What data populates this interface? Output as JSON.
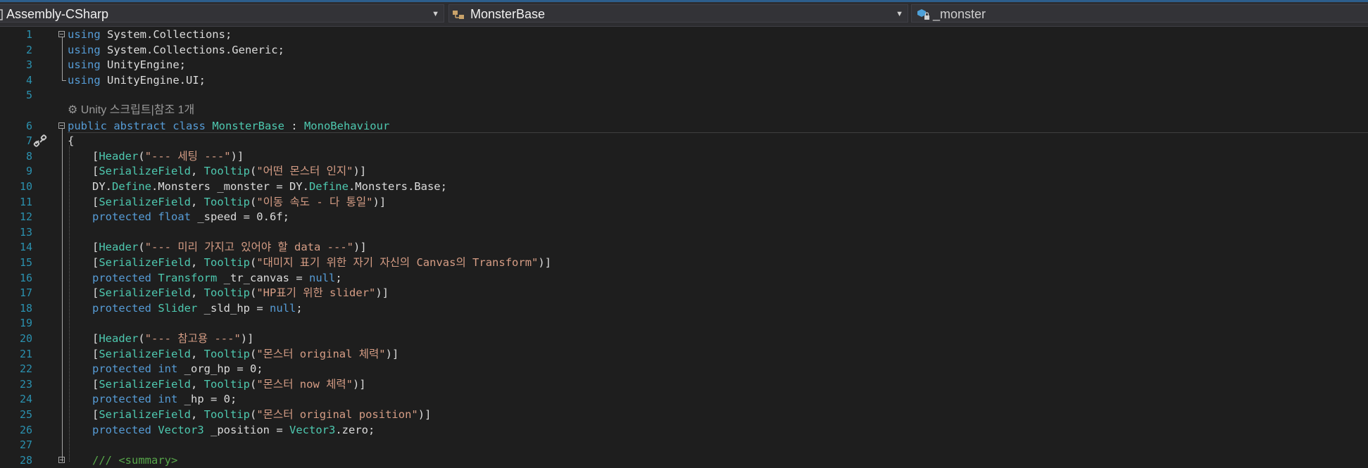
{
  "navbar": {
    "project": "Assembly-CSharp",
    "class": "MonsterBase",
    "member": "_monster"
  },
  "codelens": "Unity 스크립트|참조 1개",
  "lines": [
    {
      "n": "1",
      "toks": [
        [
          "kw",
          "using"
        ],
        [
          "pl",
          " System.Collections;"
        ]
      ]
    },
    {
      "n": "2",
      "toks": [
        [
          "kw",
          "using"
        ],
        [
          "pl",
          " System.Collections.Generic;"
        ]
      ]
    },
    {
      "n": "3",
      "toks": [
        [
          "kw",
          "using"
        ],
        [
          "pl",
          " UnityEngine;"
        ]
      ]
    },
    {
      "n": "4",
      "toks": [
        [
          "kw",
          "using"
        ],
        [
          "pl",
          " UnityEngine.UI;"
        ]
      ]
    },
    {
      "n": "5",
      "toks": []
    },
    {
      "n": "6",
      "toks": [
        [
          "kw",
          "public abstract class"
        ],
        [
          "pl",
          " "
        ],
        [
          "ty",
          "MonsterBase"
        ],
        [
          "pl",
          " : "
        ],
        [
          "ty",
          "MonoBehaviour"
        ]
      ]
    },
    {
      "n": "7",
      "toks": [
        [
          "pl",
          "{"
        ]
      ]
    },
    {
      "n": "8",
      "toks": [
        [
          "pl",
          "["
        ],
        [
          "ty",
          "Header"
        ],
        [
          "pl",
          "("
        ],
        [
          "st",
          "\"--- 세팅 ---\""
        ],
        [
          "pl",
          ")]"
        ]
      ]
    },
    {
      "n": "9",
      "toks": [
        [
          "pl",
          "["
        ],
        [
          "ty",
          "SerializeField"
        ],
        [
          "pl",
          ", "
        ],
        [
          "ty",
          "Tooltip"
        ],
        [
          "pl",
          "("
        ],
        [
          "st",
          "\"어떤 몬스터 인지\""
        ],
        [
          "pl",
          ")]"
        ]
      ]
    },
    {
      "n": "10",
      "toks": [
        [
          "pl",
          "DY."
        ],
        [
          "ty",
          "Define"
        ],
        [
          "pl",
          ".Monsters _monster = DY."
        ],
        [
          "ty",
          "Define"
        ],
        [
          "pl",
          ".Monsters.Base;"
        ]
      ]
    },
    {
      "n": "11",
      "toks": [
        [
          "pl",
          "["
        ],
        [
          "ty",
          "SerializeField"
        ],
        [
          "pl",
          ", "
        ],
        [
          "ty",
          "Tooltip"
        ],
        [
          "pl",
          "("
        ],
        [
          "st",
          "\"이동 속도 - 다 통일\""
        ],
        [
          "pl",
          ")]"
        ]
      ]
    },
    {
      "n": "12",
      "toks": [
        [
          "kw",
          "protected float"
        ],
        [
          "pl",
          " _speed = 0.6f;"
        ]
      ]
    },
    {
      "n": "13",
      "toks": []
    },
    {
      "n": "14",
      "toks": [
        [
          "pl",
          "["
        ],
        [
          "ty",
          "Header"
        ],
        [
          "pl",
          "("
        ],
        [
          "st",
          "\"--- 미리 가지고 있어야 할 data ---\""
        ],
        [
          "pl",
          ")]"
        ]
      ]
    },
    {
      "n": "15",
      "toks": [
        [
          "pl",
          "["
        ],
        [
          "ty",
          "SerializeField"
        ],
        [
          "pl",
          ", "
        ],
        [
          "ty",
          "Tooltip"
        ],
        [
          "pl",
          "("
        ],
        [
          "st",
          "\"대미지 표기 위한 자기 자신의 Canvas의 Transform\""
        ],
        [
          "pl",
          ")]"
        ]
      ]
    },
    {
      "n": "16",
      "toks": [
        [
          "kw",
          "protected"
        ],
        [
          "pl",
          " "
        ],
        [
          "ty",
          "Transform"
        ],
        [
          "pl",
          " _tr_canvas = "
        ],
        [
          "kw",
          "null"
        ],
        [
          "pl",
          ";"
        ]
      ]
    },
    {
      "n": "17",
      "toks": [
        [
          "pl",
          "["
        ],
        [
          "ty",
          "SerializeField"
        ],
        [
          "pl",
          ", "
        ],
        [
          "ty",
          "Tooltip"
        ],
        [
          "pl",
          "("
        ],
        [
          "st",
          "\"HP표기 위한 slider\""
        ],
        [
          "pl",
          ")]"
        ]
      ]
    },
    {
      "n": "18",
      "toks": [
        [
          "kw",
          "protected"
        ],
        [
          "pl",
          " "
        ],
        [
          "ty",
          "Slider"
        ],
        [
          "pl",
          " _sld_hp = "
        ],
        [
          "kw",
          "null"
        ],
        [
          "pl",
          ";"
        ]
      ]
    },
    {
      "n": "19",
      "toks": []
    },
    {
      "n": "20",
      "toks": [
        [
          "pl",
          "["
        ],
        [
          "ty",
          "Header"
        ],
        [
          "pl",
          "("
        ],
        [
          "st",
          "\"--- 참고용 ---\""
        ],
        [
          "pl",
          ")]"
        ]
      ]
    },
    {
      "n": "21",
      "toks": [
        [
          "pl",
          "["
        ],
        [
          "ty",
          "SerializeField"
        ],
        [
          "pl",
          ", "
        ],
        [
          "ty",
          "Tooltip"
        ],
        [
          "pl",
          "("
        ],
        [
          "st",
          "\"몬스터 original 체력\""
        ],
        [
          "pl",
          ")]"
        ]
      ]
    },
    {
      "n": "22",
      "toks": [
        [
          "kw",
          "protected int"
        ],
        [
          "pl",
          " _org_hp = 0;"
        ]
      ]
    },
    {
      "n": "23",
      "toks": [
        [
          "pl",
          "["
        ],
        [
          "ty",
          "SerializeField"
        ],
        [
          "pl",
          ", "
        ],
        [
          "ty",
          "Tooltip"
        ],
        [
          "pl",
          "("
        ],
        [
          "st",
          "\"몬스터 now 체력\""
        ],
        [
          "pl",
          ")]"
        ]
      ]
    },
    {
      "n": "24",
      "toks": [
        [
          "kw",
          "protected int"
        ],
        [
          "pl",
          " _hp = 0;"
        ]
      ]
    },
    {
      "n": "25",
      "toks": [
        [
          "pl",
          "["
        ],
        [
          "ty",
          "SerializeField"
        ],
        [
          "pl",
          ", "
        ],
        [
          "ty",
          "Tooltip"
        ],
        [
          "pl",
          "("
        ],
        [
          "st",
          "\"몬스터 original position\""
        ],
        [
          "pl",
          ")]"
        ]
      ]
    },
    {
      "n": "26",
      "toks": [
        [
          "kw",
          "protected"
        ],
        [
          "pl",
          " "
        ],
        [
          "ty",
          "Vector3"
        ],
        [
          "pl",
          " _position = "
        ],
        [
          "ty",
          "Vector3"
        ],
        [
          "pl",
          ".zero;"
        ]
      ]
    },
    {
      "n": "27",
      "toks": []
    },
    {
      "n": "28",
      "toks": [
        [
          "cm",
          "/// <summary>"
        ]
      ]
    }
  ]
}
